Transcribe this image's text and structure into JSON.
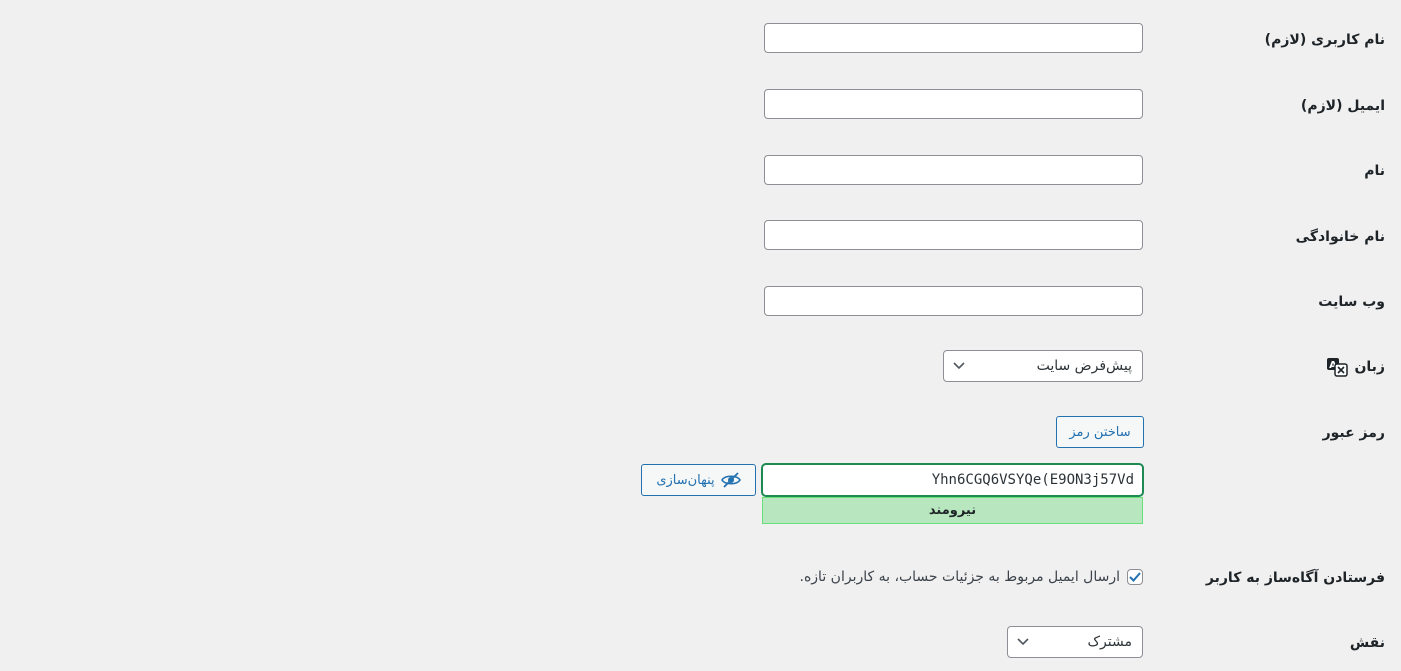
{
  "form": {
    "username": {
      "label": "نام کاربری (لازم)",
      "value": ""
    },
    "email": {
      "label": "ایمیل (لازم)",
      "value": ""
    },
    "first_name": {
      "label": "نام",
      "value": ""
    },
    "last_name": {
      "label": "نام خانوادگی",
      "value": ""
    },
    "website": {
      "label": "وب سایت",
      "value": ""
    },
    "language": {
      "label": "زبان",
      "icon": "translate-icon",
      "selected": "پیش‌فرض سایت"
    },
    "password": {
      "label": "رمز عبور",
      "generate_button": "ساختن رمز",
      "value": "Yhn6CGQ6VSYQe(E9ON3j57Vd",
      "hide_button": "پنهان‌سازی",
      "hide_icon": "eye-slash-icon",
      "strength": "نیرومند",
      "strength_color": "#b8e6bf"
    },
    "notification": {
      "label": "فرستادن آگاه‌ساز به کاربر",
      "checkbox_text": "ارسال ایمیل مربوط به جزئیات حساب، به کاربران تازه.",
      "checked": true
    },
    "role": {
      "label": "نقش",
      "selected": "مشترک"
    }
  },
  "colors": {
    "accent": "#2271b1",
    "background": "#f0f0f1",
    "strong": "#68de7c"
  }
}
